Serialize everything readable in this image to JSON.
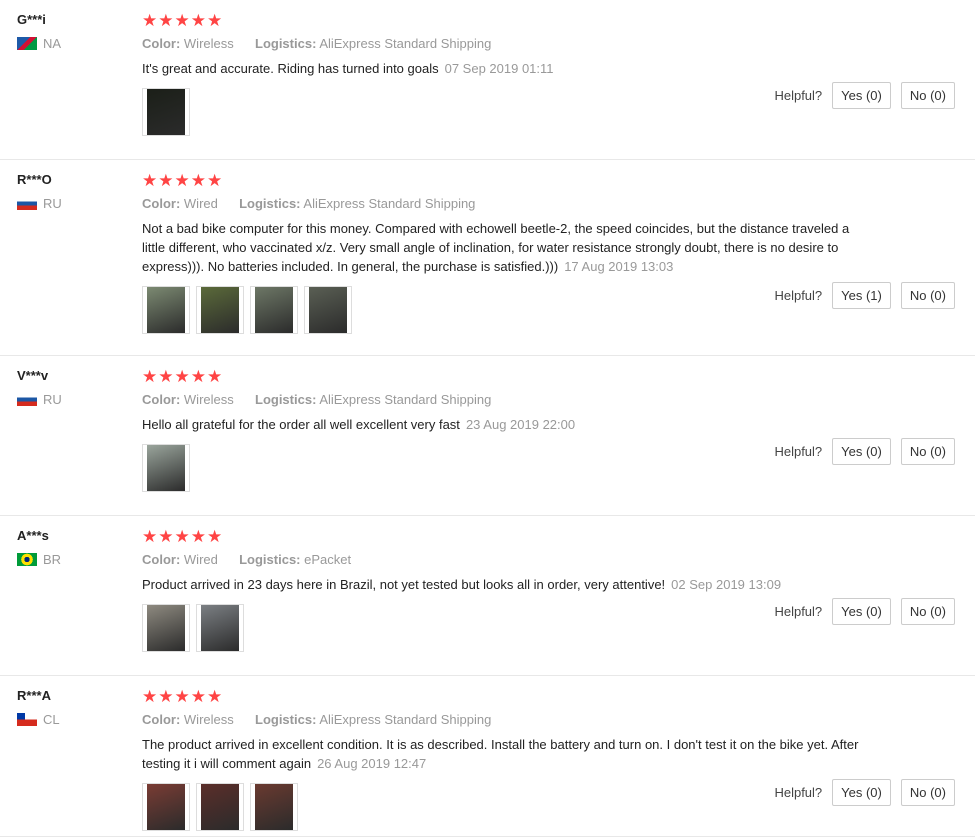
{
  "reviews": [
    {
      "user": "G***i",
      "country": "NA",
      "flag_colors": [
        "#1e5aa8",
        "#d21034",
        "#009a44",
        "#ffd100"
      ],
      "stars": "★★★★★",
      "color_label": "Color:",
      "color_value": "Wireless",
      "logistics_label": "Logistics:",
      "logistics_value": "AliExpress Standard Shipping",
      "text": "It's great and accurate. Riding has turned into goals",
      "date": "07 Sep 2019 01:11",
      "images": [
        {
          "icon": "review-photo-icon",
          "tone": "#1b1f18"
        }
      ],
      "helpful_label": "Helpful?",
      "yes": "Yes (0)",
      "no": "No (0)"
    },
    {
      "user": "R***O",
      "country": "RU",
      "flag_colors": [
        "#ffffff",
        "#1c57a5",
        "#d52b1e"
      ],
      "stars": "★★★★★",
      "color_label": "Color:",
      "color_value": "Wired",
      "logistics_label": "Logistics:",
      "logistics_value": "AliExpress Standard Shipping",
      "text": "Not a bad bike computer for this money. Compared with echowell beetle-2, the speed coincides, but the distance traveled a little different, who vaccinated x/z. Very small angle of inclination, for water resistance strongly doubt, there is no desire to express))). No batteries included. In general, the purchase is satisfied.)))",
      "date": "17 Aug 2019 13:03",
      "images": [
        {
          "icon": "review-photo-icon",
          "tone": "#7c8a72"
        },
        {
          "icon": "review-photo-icon",
          "tone": "#5b6a3a"
        },
        {
          "icon": "review-photo-icon",
          "tone": "#6d7766"
        },
        {
          "icon": "review-photo-icon",
          "tone": "#5a5f54"
        }
      ],
      "helpful_label": "Helpful?",
      "yes": "Yes (1)",
      "no": "No (0)"
    },
    {
      "user": "V***v",
      "country": "RU",
      "flag_colors": [
        "#ffffff",
        "#1c57a5",
        "#d52b1e"
      ],
      "stars": "★★★★★",
      "color_label": "Color:",
      "color_value": "Wireless",
      "logistics_label": "Logistics:",
      "logistics_value": "AliExpress Standard Shipping",
      "text": "Hello all grateful for the order all well excellent very fast",
      "date": "23 Aug 2019 22:00",
      "images": [
        {
          "icon": "review-photo-icon",
          "tone": "#9aa59c"
        }
      ],
      "helpful_label": "Helpful?",
      "yes": "Yes (0)",
      "no": "No (0)"
    },
    {
      "user": "A***s",
      "country": "BR",
      "flag_colors": [
        "#009b3a",
        "#fedf00",
        "#002776"
      ],
      "stars": "★★★★★",
      "color_label": "Color:",
      "color_value": "Wired",
      "logistics_label": "Logistics:",
      "logistics_value": "ePacket",
      "text": "Product arrived in 23 days here in Brazil, not yet tested but looks all in order, very attentive!",
      "date": "02 Sep 2019 13:09",
      "images": [
        {
          "icon": "review-photo-icon",
          "tone": "#8e8a80"
        },
        {
          "icon": "review-photo-icon",
          "tone": "#7b7f83"
        }
      ],
      "helpful_label": "Helpful?",
      "yes": "Yes (0)",
      "no": "No (0)"
    },
    {
      "user": "R***A",
      "country": "CL",
      "flag_colors": [
        "#ffffff",
        "#d52b1e",
        "#0039a6"
      ],
      "stars": "★★★★★",
      "color_label": "Color:",
      "color_value": "Wireless",
      "logistics_label": "Logistics:",
      "logistics_value": "AliExpress Standard Shipping",
      "text": "The product arrived in excellent condition. It is as described. Install the battery and turn on. I don't test it on the bike yet. After testing it i will comment again",
      "date": "26 Aug 2019 12:47",
      "images": [
        {
          "icon": "review-photo-icon",
          "tone": "#7a3c34"
        },
        {
          "icon": "review-photo-icon",
          "tone": "#5b2e2a"
        },
        {
          "icon": "review-photo-icon",
          "tone": "#6a3a30"
        }
      ],
      "helpful_label": "Helpful?",
      "yes": "Yes (0)",
      "no": "No (0)"
    }
  ]
}
